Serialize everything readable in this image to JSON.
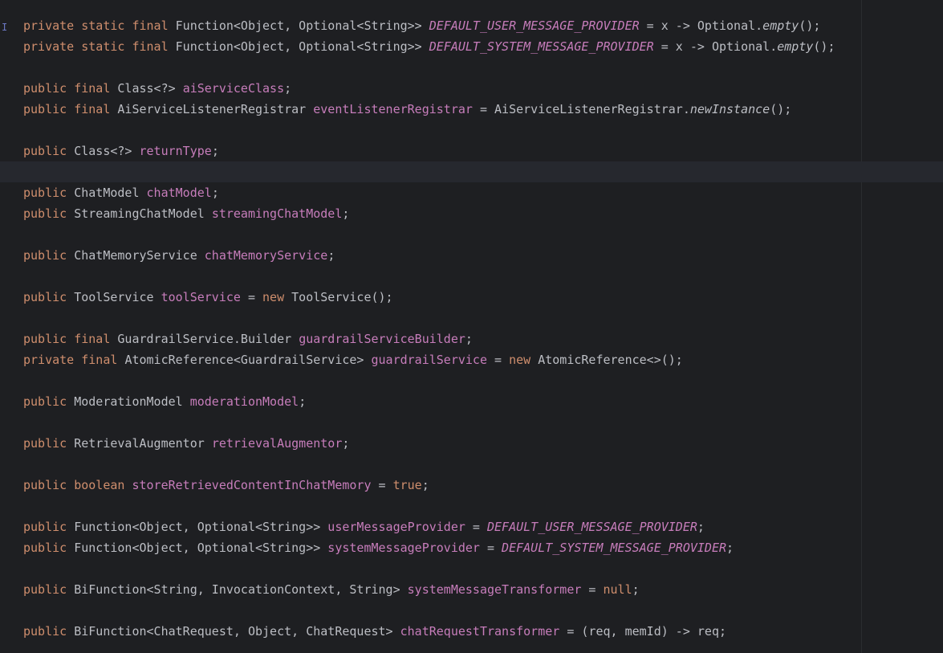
{
  "editor": {
    "colors": {
      "background": "#1e1f22",
      "keyword": "#cf8e6d",
      "field": "#c77dbb",
      "text": "#bcbec4",
      "current_line": "#26282e"
    },
    "lines": [
      [
        {
          "k": "kw",
          "t": "private static final "
        },
        {
          "k": "txt",
          "t": "Function<Object, Optional<String>> "
        },
        {
          "k": "cst",
          "t": "DEFAULT_USER_MESSAGE_PROVIDER"
        },
        {
          "k": "txt",
          "t": " = x -> Optional."
        },
        {
          "k": "itl",
          "t": "empty"
        },
        {
          "k": "txt",
          "t": "();"
        }
      ],
      [
        {
          "k": "kw",
          "t": "private static final "
        },
        {
          "k": "txt",
          "t": "Function<Object, Optional<String>> "
        },
        {
          "k": "cst",
          "t": "DEFAULT_SYSTEM_MESSAGE_PROVIDER"
        },
        {
          "k": "txt",
          "t": " = x -> Optional."
        },
        {
          "k": "itl",
          "t": "empty"
        },
        {
          "k": "txt",
          "t": "();"
        }
      ],
      [],
      [
        {
          "k": "kw",
          "t": "public final "
        },
        {
          "k": "txt",
          "t": "Class<?> "
        },
        {
          "k": "fld",
          "t": "aiServiceClass"
        },
        {
          "k": "txt",
          "t": ";"
        }
      ],
      [
        {
          "k": "kw",
          "t": "public final "
        },
        {
          "k": "txt",
          "t": "AiServiceListenerRegistrar "
        },
        {
          "k": "fld",
          "t": "eventListenerRegistrar"
        },
        {
          "k": "txt",
          "t": " = AiServiceListenerRegistrar."
        },
        {
          "k": "itl",
          "t": "newInstance"
        },
        {
          "k": "txt",
          "t": "();"
        }
      ],
      [],
      [
        {
          "k": "kw",
          "t": "public "
        },
        {
          "k": "txt",
          "t": "Class<?> "
        },
        {
          "k": "fld",
          "t": "returnType"
        },
        {
          "k": "txt",
          "t": ";"
        }
      ],
      [],
      [
        {
          "k": "kw",
          "t": "public "
        },
        {
          "k": "txt",
          "t": "ChatModel "
        },
        {
          "k": "fld",
          "t": "chatModel"
        },
        {
          "k": "txt",
          "t": ";"
        }
      ],
      [
        {
          "k": "kw",
          "t": "public "
        },
        {
          "k": "txt",
          "t": "StreamingChatModel "
        },
        {
          "k": "fld",
          "t": "streamingChatModel"
        },
        {
          "k": "txt",
          "t": ";"
        }
      ],
      [],
      [
        {
          "k": "kw",
          "t": "public "
        },
        {
          "k": "txt",
          "t": "ChatMemoryService "
        },
        {
          "k": "fld",
          "t": "chatMemoryService"
        },
        {
          "k": "txt",
          "t": ";"
        }
      ],
      [],
      [
        {
          "k": "kw",
          "t": "public "
        },
        {
          "k": "txt",
          "t": "ToolService "
        },
        {
          "k": "fld",
          "t": "toolService"
        },
        {
          "k": "txt",
          "t": " = "
        },
        {
          "k": "kw",
          "t": "new "
        },
        {
          "k": "txt",
          "t": "ToolService();"
        }
      ],
      [],
      [
        {
          "k": "kw",
          "t": "public final "
        },
        {
          "k": "txt",
          "t": "GuardrailService.Builder "
        },
        {
          "k": "fld",
          "t": "guardrailServiceBuilder"
        },
        {
          "k": "txt",
          "t": ";"
        }
      ],
      [
        {
          "k": "kw",
          "t": "private final "
        },
        {
          "k": "txt",
          "t": "AtomicReference<GuardrailService> "
        },
        {
          "k": "fld",
          "t": "guardrailService"
        },
        {
          "k": "txt",
          "t": " = "
        },
        {
          "k": "kw",
          "t": "new "
        },
        {
          "k": "txt",
          "t": "AtomicReference<>();"
        }
      ],
      [],
      [
        {
          "k": "kw",
          "t": "public "
        },
        {
          "k": "txt",
          "t": "ModerationModel "
        },
        {
          "k": "fld",
          "t": "moderationModel"
        },
        {
          "k": "txt",
          "t": ";"
        }
      ],
      [],
      [
        {
          "k": "kw",
          "t": "public "
        },
        {
          "k": "txt",
          "t": "RetrievalAugmentor "
        },
        {
          "k": "fld",
          "t": "retrievalAugmentor"
        },
        {
          "k": "txt",
          "t": ";"
        }
      ],
      [],
      [
        {
          "k": "kw",
          "t": "public boolean "
        },
        {
          "k": "fld",
          "t": "storeRetrievedContentInChatMemory"
        },
        {
          "k": "txt",
          "t": " = "
        },
        {
          "k": "kw",
          "t": "true"
        },
        {
          "k": "txt",
          "t": ";"
        }
      ],
      [],
      [
        {
          "k": "kw",
          "t": "public "
        },
        {
          "k": "txt",
          "t": "Function<Object, Optional<String>> "
        },
        {
          "k": "fld",
          "t": "userMessageProvider"
        },
        {
          "k": "txt",
          "t": " = "
        },
        {
          "k": "cst",
          "t": "DEFAULT_USER_MESSAGE_PROVIDER"
        },
        {
          "k": "txt",
          "t": ";"
        }
      ],
      [
        {
          "k": "kw",
          "t": "public "
        },
        {
          "k": "txt",
          "t": "Function<Object, Optional<String>> "
        },
        {
          "k": "fld",
          "t": "systemMessageProvider"
        },
        {
          "k": "txt",
          "t": " = "
        },
        {
          "k": "cst",
          "t": "DEFAULT_SYSTEM_MESSAGE_PROVIDER"
        },
        {
          "k": "txt",
          "t": ";"
        }
      ],
      [],
      [
        {
          "k": "kw",
          "t": "public "
        },
        {
          "k": "txt",
          "t": "BiFunction<String, InvocationContext, String> "
        },
        {
          "k": "fld",
          "t": "systemMessageTransformer"
        },
        {
          "k": "txt",
          "t": " = "
        },
        {
          "k": "kw",
          "t": "null"
        },
        {
          "k": "txt",
          "t": ";"
        }
      ],
      [],
      [
        {
          "k": "kw",
          "t": "public "
        },
        {
          "k": "txt",
          "t": "BiFunction<ChatRequest, Object, ChatRequest> "
        },
        {
          "k": "fld",
          "t": "chatRequestTransformer"
        },
        {
          "k": "txt",
          "t": " = (req, memId) -> req;"
        }
      ]
    ]
  },
  "gutter": {
    "caret_icon": "text-cursor-icon",
    "caret_glyph": "I"
  }
}
